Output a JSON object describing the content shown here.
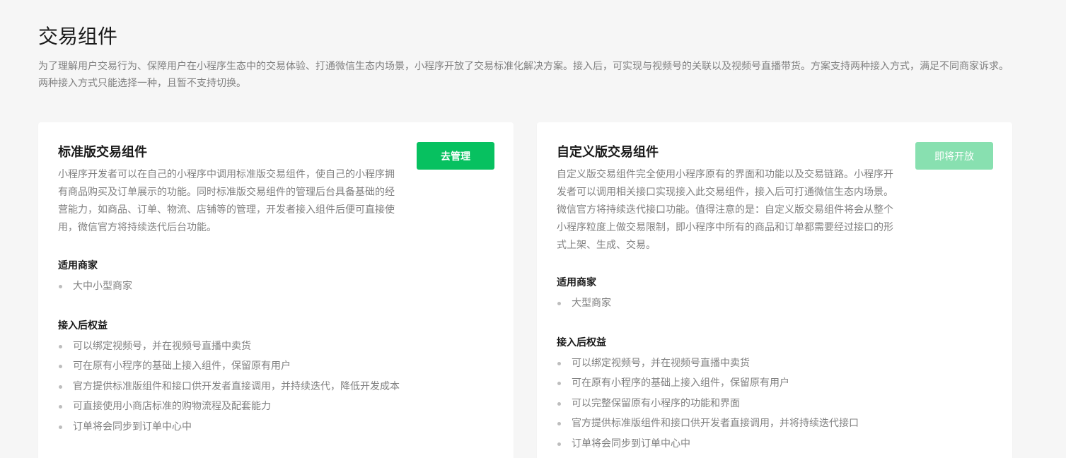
{
  "page": {
    "title": "交易组件",
    "description": "为了理解用户交易行为、保障用户在小程序生态中的交易体验、打通微信生态内场景，小程序开放了交易标准化解决方案。接入后，可实现与视频号的关联以及视频号直播带货。方案支持两种接入方式，满足不同商家诉求。两种接入方式只能选择一种，且暂不支持切换。"
  },
  "colors": {
    "accent": "#07c160",
    "accent_disabled": "#88e0b0",
    "background": "#f6f6f6",
    "text_primary": "#1a1a1a",
    "text_secondary": "#808080"
  },
  "cards": [
    {
      "title": "标准版交易组件",
      "button_label": "去管理",
      "button_enabled": true,
      "description": "小程序开发者可以在自己的小程序中调用标准版交易组件，使自己的小程序拥有商品购买及订单展示的功能。同时标准版交易组件的管理后台具备基础的经营能力，如商品、订单、物流、店铺等的管理，开发者接入组件后便可直接使用，微信官方将持续迭代后台功能。",
      "merchants_title": "适用商家",
      "merchants": [
        "大中小型商家"
      ],
      "benefits_title": "接入后权益",
      "benefits": [
        "可以绑定视频号，并在视频号直播中卖货",
        "可在原有小程序的基础上接入组件，保留原有用户",
        "官方提供标准版组件和接口供开发者直接调用，并持续迭代，降低开发成本",
        "可直接使用小商店标准的购物流程及配套能力",
        "订单将会同步到订单中心中"
      ]
    },
    {
      "title": "自定义版交易组件",
      "button_label": "即将开放",
      "button_enabled": false,
      "description": "自定义版交易组件完全使用小程序原有的界面和功能以及交易链路。小程序开发者可以调用相关接口实现接入此交易组件，接入后可打通微信生态内场景。微信官方将持续迭代接口功能。值得注意的是：自定义版交易组件将会从整个小程序粒度上做交易限制，即小程序中所有的商品和订单都需要经过接口的形式上架、生成、交易。",
      "merchants_title": "适用商家",
      "merchants": [
        "大型商家"
      ],
      "benefits_title": "接入后权益",
      "benefits": [
        "可以绑定视频号，并在视频号直播中卖货",
        "可在原有小程序的基础上接入组件，保留原有用户",
        "可以完整保留原有小程序的功能和界面",
        "官方提供标准版组件和接口供开发者直接调用，并将持续迭代接口",
        "订单将会同步到订单中心中"
      ]
    }
  ]
}
